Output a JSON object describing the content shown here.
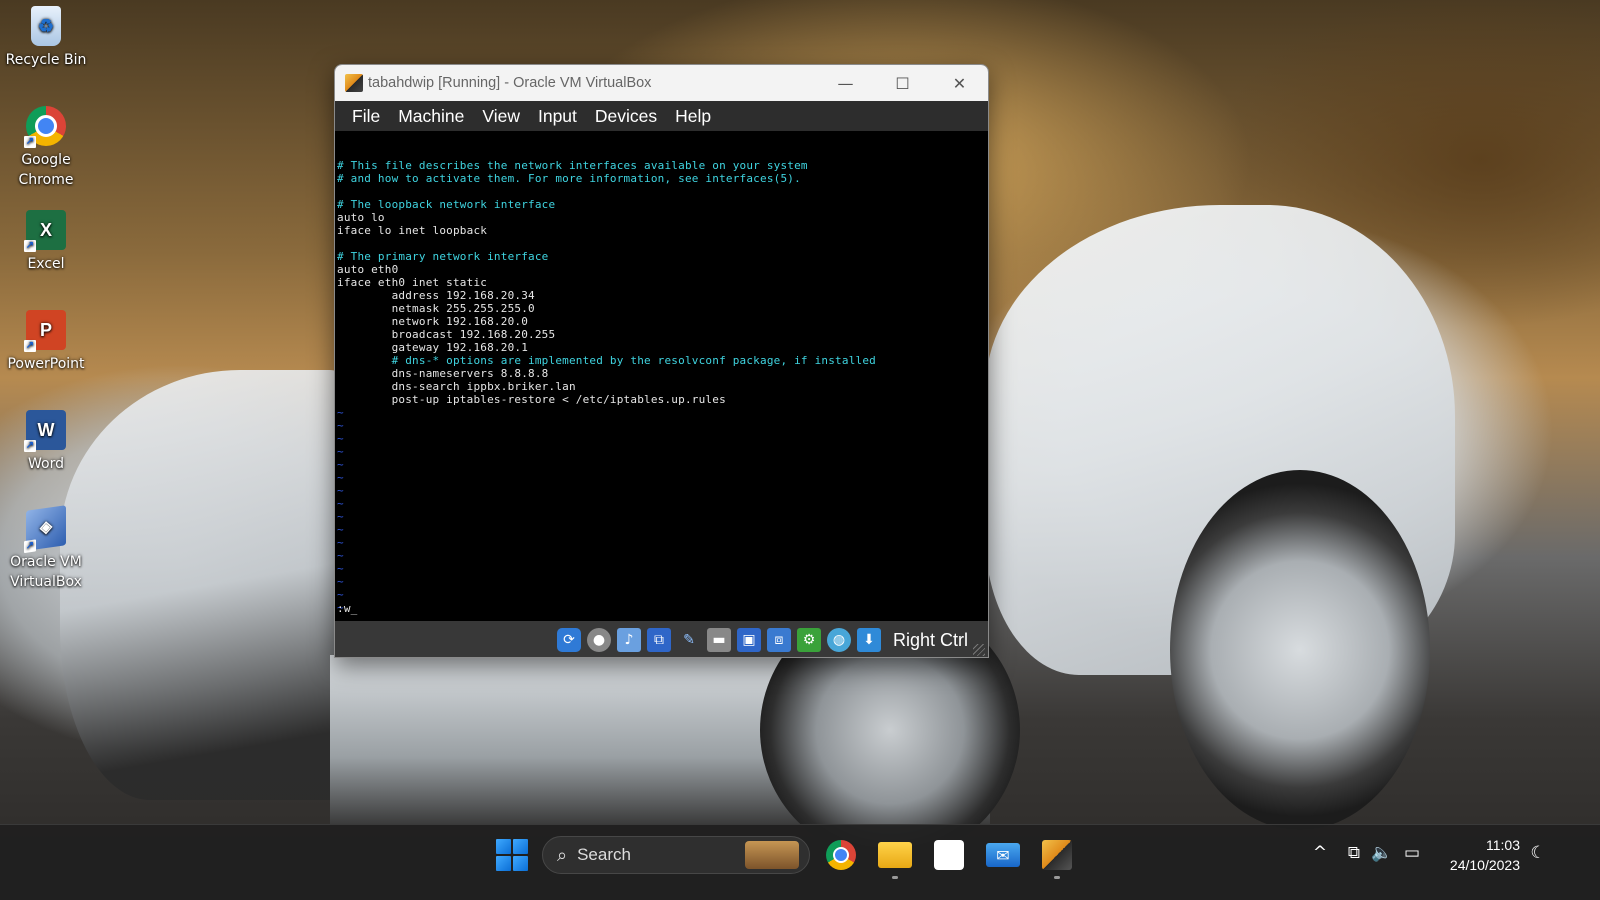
{
  "desktop": {
    "icons": [
      {
        "label": "Recycle Bin",
        "icon": "recycle-bin-icon"
      },
      {
        "label": "Google Chrome",
        "icon": "chrome-icon"
      },
      {
        "label": "Excel",
        "icon": "excel-icon"
      },
      {
        "label": "PowerPoint",
        "icon": "powerpoint-icon"
      },
      {
        "label": "Word",
        "icon": "word-icon"
      },
      {
        "label": "Oracle VM VirtualBox",
        "icon": "virtualbox-icon"
      }
    ],
    "icon_glyphs": {
      "recycle": "♻",
      "excel": "X",
      "powerpoint": "P",
      "word": "W",
      "vbox": "◈",
      "shortcut": "↗"
    }
  },
  "window": {
    "title": "tabahdwip [Running] - Oracle VM VirtualBox",
    "controls": {
      "minimize": "—",
      "maximize": "☐",
      "close": "✕"
    },
    "menu": [
      "File",
      "Machine",
      "View",
      "Input",
      "Devices",
      "Help"
    ]
  },
  "console": {
    "lines": [
      {
        "text": "# This file describes the network interfaces available on your system",
        "type": "comment"
      },
      {
        "text": "# and how to activate them. For more information, see interfaces(5).",
        "type": "comment"
      },
      {
        "text": "",
        "type": "plain"
      },
      {
        "text": "# The loopback network interface",
        "type": "comment"
      },
      {
        "text": "auto lo",
        "type": "plain"
      },
      {
        "text": "iface lo inet loopback",
        "type": "plain"
      },
      {
        "text": "",
        "type": "plain"
      },
      {
        "text": "# The primary network interface",
        "type": "comment"
      },
      {
        "text": "auto eth0",
        "type": "plain"
      },
      {
        "text": "iface eth0 inet static",
        "type": "plain"
      },
      {
        "text": "        address 192.168.20.34",
        "type": "plain"
      },
      {
        "text": "        netmask 255.255.255.0",
        "type": "plain"
      },
      {
        "text": "        network 192.168.20.0",
        "type": "plain"
      },
      {
        "text": "        broadcast 192.168.20.255",
        "type": "plain"
      },
      {
        "text": "        gateway 192.168.20.1",
        "type": "plain"
      },
      {
        "text": "        # dns-* options are implemented by the resolvconf package, if installed",
        "type": "comment"
      },
      {
        "text": "        dns-nameservers 8.8.8.8",
        "type": "plain"
      },
      {
        "text": "        dns-search ippbx.briker.lan",
        "type": "plain"
      },
      {
        "text": "        post-up iptables-restore < /etc/iptables.up.rules",
        "type": "plain"
      }
    ],
    "tilde": "~",
    "tilde_count": 16,
    "command": ":w_"
  },
  "statusbar": {
    "icons": [
      {
        "name": "hard-disk-icon",
        "glyph": "⟳"
      },
      {
        "name": "optical-drive-icon",
        "glyph": "●"
      },
      {
        "name": "audio-icon",
        "glyph": "♪"
      },
      {
        "name": "network-icon",
        "glyph": "⧉"
      },
      {
        "name": "usb-icon",
        "glyph": "✎"
      },
      {
        "name": "shared-folders-icon",
        "glyph": "▬"
      },
      {
        "name": "display-icon",
        "glyph": "▣"
      },
      {
        "name": "recording-icon",
        "glyph": "⧈"
      },
      {
        "name": "cpu-icon",
        "glyph": "⚙"
      },
      {
        "name": "guest-additions-icon",
        "glyph": "◍"
      },
      {
        "name": "mouse-integration-icon",
        "glyph": "⬇"
      }
    ],
    "host_key": "Right Ctrl"
  },
  "taskbar": {
    "search_label": "Search",
    "search_glyph": "⌕",
    "mail_glyph": "✉",
    "tray": {
      "chevron": "^",
      "network": "⧉",
      "volume": "🔈",
      "battery": "▭",
      "night": "☾"
    },
    "clock": {
      "time": "11:03",
      "date": "24/10/2023"
    }
  }
}
